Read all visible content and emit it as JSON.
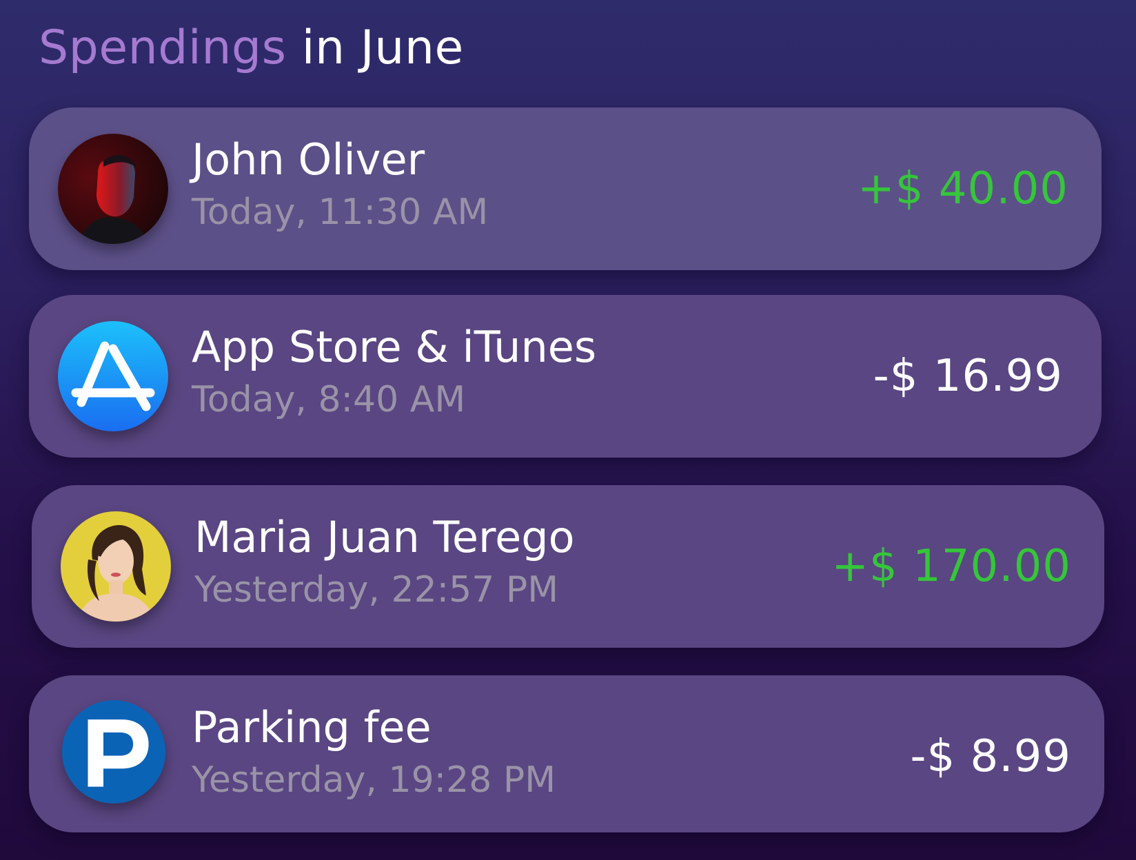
{
  "header": {
    "title_accent": "Spendings",
    "title_rest": "in June"
  },
  "colors": {
    "accent": "#a57ad0",
    "positive": "#35c63a",
    "negative": "#ffffff",
    "card": "#5a4682"
  },
  "transactions": [
    {
      "name": "John Oliver",
      "time": "Today, 11:30 AM",
      "amount": "+$ 40.00",
      "type": "income",
      "icon": "person-avatar"
    },
    {
      "name": "App Store & iTunes",
      "time": "Today, 8:40 AM",
      "amount": "-$ 16.99",
      "type": "expense",
      "icon": "app-store-icon"
    },
    {
      "name": "Maria Juan Terego",
      "time": "Yesterday, 22:57 PM",
      "amount": "+$ 170.00",
      "type": "income",
      "icon": "person-avatar"
    },
    {
      "name": "Parking fee",
      "time": "Yesterday, 19:28 PM",
      "amount": "-$ 8.99",
      "type": "expense",
      "icon": "parking-icon"
    }
  ]
}
